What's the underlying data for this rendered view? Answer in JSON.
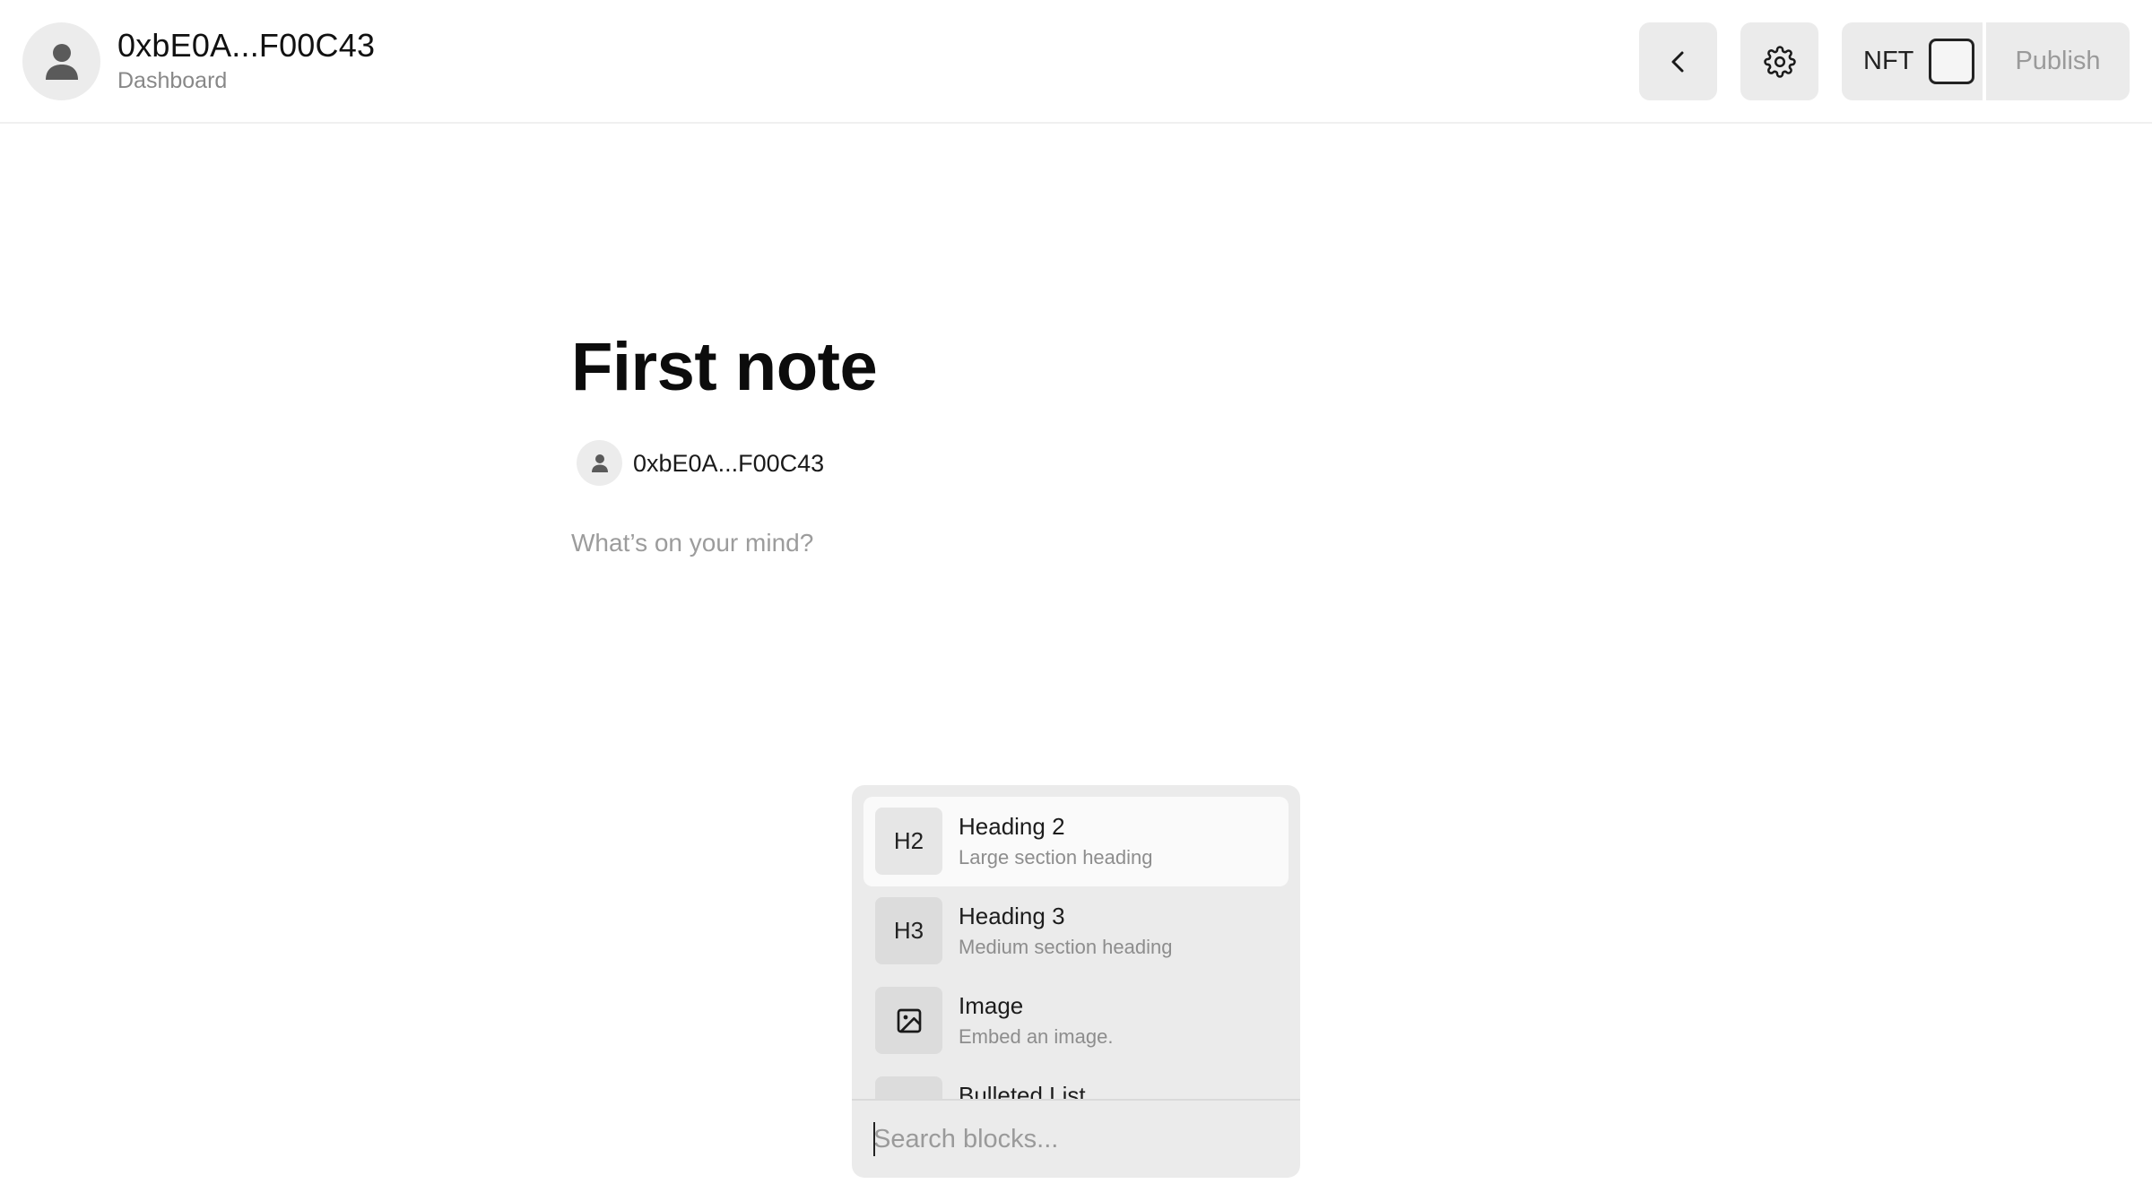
{
  "header": {
    "account_name": "0xbE0A...F00C43",
    "account_sub": "Dashboard",
    "nft_label": "NFT",
    "nft_checked": false,
    "publish_label": "Publish"
  },
  "note": {
    "title": "First note",
    "author": "0xbE0A...F00C43",
    "body_placeholder": "What’s on your mind?"
  },
  "block_menu": {
    "items": [
      {
        "icon": "H2",
        "label": "Heading 2",
        "description": "Large section heading",
        "active": true
      },
      {
        "icon": "H3",
        "label": "Heading 3",
        "description": "Medium section heading",
        "active": false
      },
      {
        "icon": "image-icon",
        "label": "Image",
        "description": "Embed an image.",
        "active": false
      },
      {
        "icon": "bulleted-list-icon",
        "label": "Bulleted List",
        "description": "",
        "active": false
      }
    ],
    "search_placeholder": "Search blocks..."
  }
}
